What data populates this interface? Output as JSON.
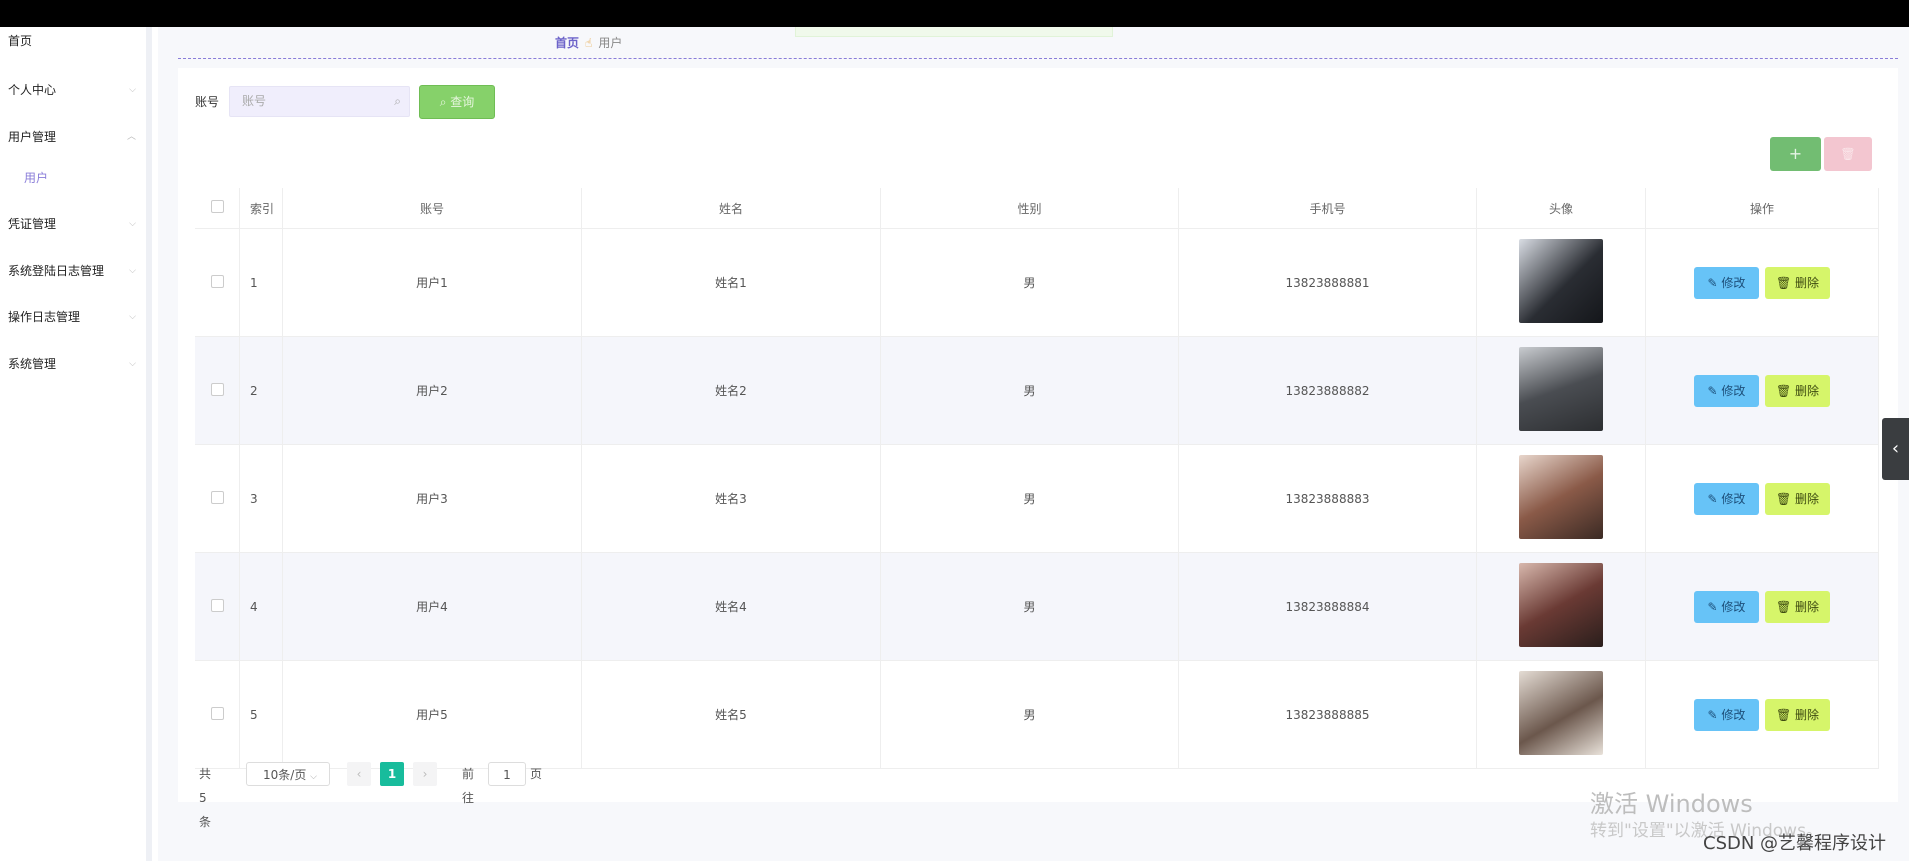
{
  "sidebar": {
    "items": [
      {
        "label": "首页"
      },
      {
        "label": "个人中心",
        "chevron": "chevron-down"
      },
      {
        "label": "用户管理",
        "chevron": "chevron-up"
      },
      {
        "label": "凭证管理",
        "chevron": "chevron-down"
      },
      {
        "label": "系统登陆日志管理",
        "chevron": "chevron-down"
      },
      {
        "label": "操作日志管理",
        "chevron": "chevron-down"
      },
      {
        "label": "系统管理",
        "chevron": "chevron-down"
      }
    ],
    "sub_item": "用户"
  },
  "breadcrumb": {
    "home": "首页",
    "separator_icon": "hand-icon",
    "current": "用户"
  },
  "search": {
    "label": "账号",
    "placeholder": "账号",
    "query_label": "查询"
  },
  "toolbar": {
    "add_label": "+",
    "delete_icon": "trash-icon"
  },
  "table": {
    "headers": {
      "index": "索引",
      "account": "账号",
      "name": "姓名",
      "gender": "性别",
      "phone": "手机号",
      "avatar": "头像",
      "actions": "操作"
    },
    "edit_label": "修改",
    "delete_label": "删除",
    "rows": [
      {
        "index": "1",
        "account": "用户1",
        "name": "姓名1",
        "gender": "男",
        "phone": "13823888881"
      },
      {
        "index": "2",
        "account": "用户2",
        "name": "姓名2",
        "gender": "男",
        "phone": "13823888882"
      },
      {
        "index": "3",
        "account": "用户3",
        "name": "姓名3",
        "gender": "男",
        "phone": "13823888883"
      },
      {
        "index": "4",
        "account": "用户4",
        "name": "姓名4",
        "gender": "男",
        "phone": "13823888884"
      },
      {
        "index": "5",
        "account": "用户5",
        "name": "姓名5",
        "gender": "男",
        "phone": "13823888885"
      }
    ]
  },
  "pagination": {
    "total": "共 5 条",
    "page_size": "10条/页",
    "current_page": "1",
    "goto_label": "前往",
    "goto_value": "1",
    "page_unit": "页"
  },
  "watermark": {
    "line1": "激活 Windows",
    "line2": "转到\"设置\"以激活 Windows。",
    "csdn": "CSDN @艺馨程序设计"
  },
  "colors": {
    "accent": "#8a7dd9",
    "query": "#86d16a",
    "add": "#72bd72",
    "edit": "#67c3f7",
    "delete": "#d6f56a",
    "page_active": "#18bc9c"
  }
}
